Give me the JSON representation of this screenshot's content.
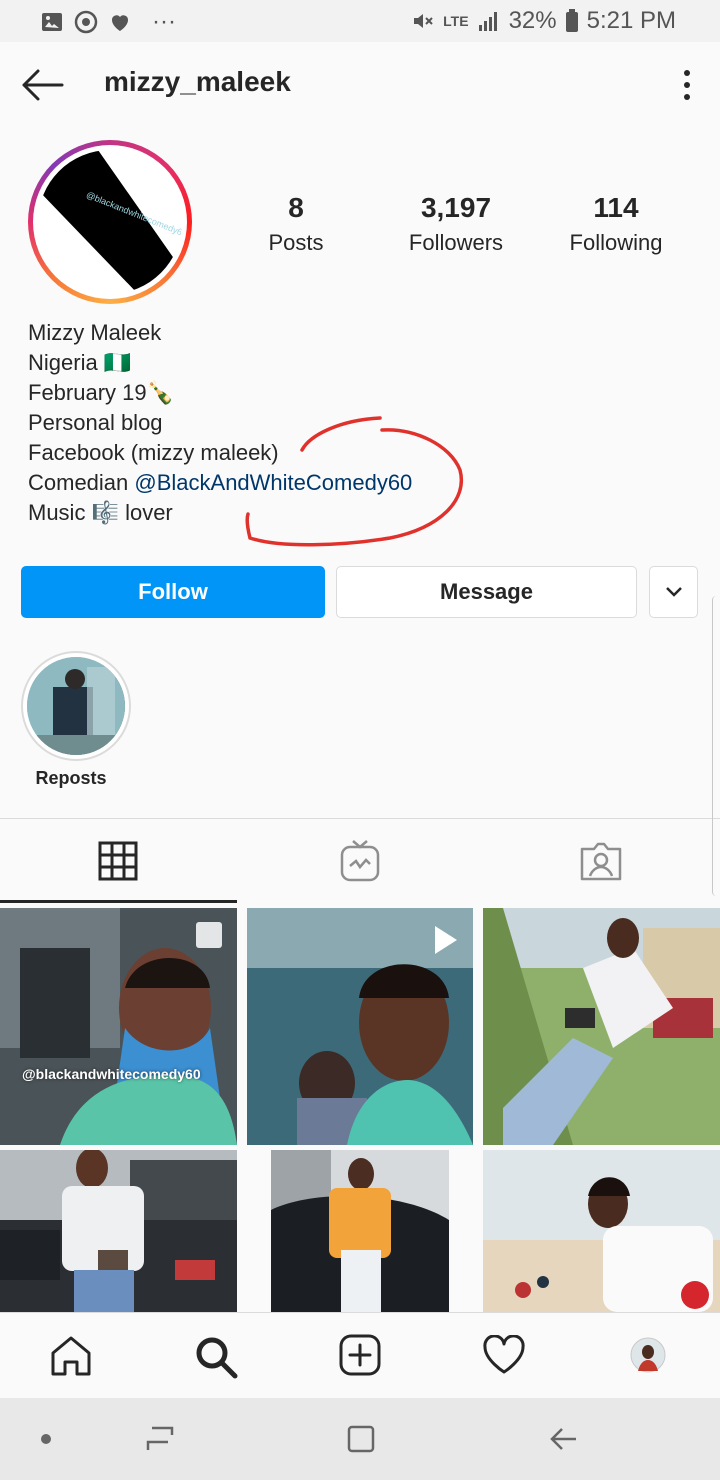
{
  "status_bar": {
    "battery": "32%",
    "time": "5:21 PM",
    "network": "LTE",
    "more": "···"
  },
  "header": {
    "username": "mizzy_maleek"
  },
  "profile": {
    "avatar_text": "@blackandwhitecomedy60",
    "stats": [
      {
        "value": "8",
        "label": "Posts"
      },
      {
        "value": "3,197",
        "label": "Followers"
      },
      {
        "value": "114",
        "label": "Following"
      }
    ],
    "bio": {
      "name": "Mizzy Maleek",
      "line1": "Nigeria 🇳🇬",
      "line2": "February 19🍾",
      "line3": "Personal blog",
      "line4": "Facebook (mizzy maleek)",
      "line5_prefix": "Comedian ",
      "line5_mention": "@BlackAndWhiteComedy60",
      "line6": "Music 🎼 lover"
    }
  },
  "actions": {
    "follow_label": "Follow",
    "message_label": "Message"
  },
  "highlights": [
    {
      "label": "Reposts"
    }
  ],
  "grid": {
    "tile1_caption": "@blackandwhitecomedy60"
  },
  "colors": {
    "follow_blue": "#0095f6",
    "mention": "#00376b",
    "annotation_red": "#e0322c"
  }
}
